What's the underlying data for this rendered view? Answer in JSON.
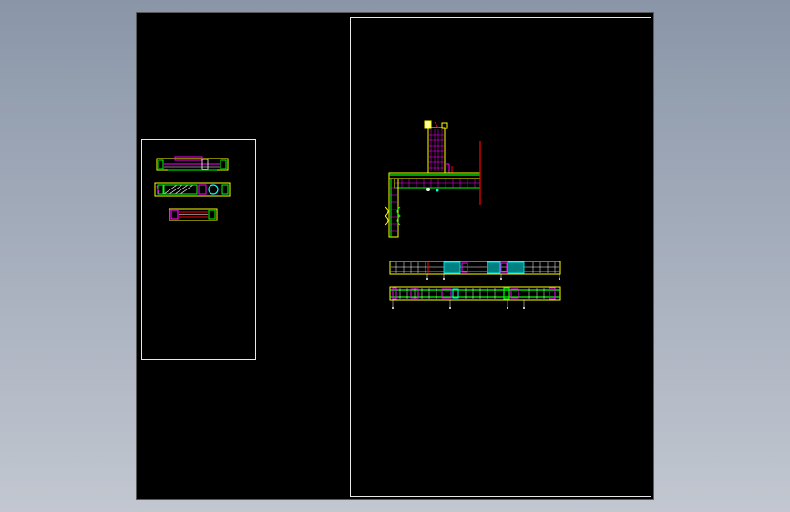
{
  "window": {
    "background_color": "#000000"
  },
  "drawing": {
    "colors": {
      "yellow": "#ffff00",
      "green": "#00ff00",
      "magenta": "#ff00ff",
      "red": "#ff0000",
      "cyan": "#00ffff",
      "white": "#ffffff",
      "blue": "#3030ff",
      "teal": "#00c0c0"
    },
    "left_sheet_details": [
      "detail-top",
      "detail-middle",
      "detail-bottom"
    ],
    "right_sheet_details": [
      "wall-junction-detail",
      "beam-elevation-top",
      "beam-elevation-bottom"
    ]
  }
}
